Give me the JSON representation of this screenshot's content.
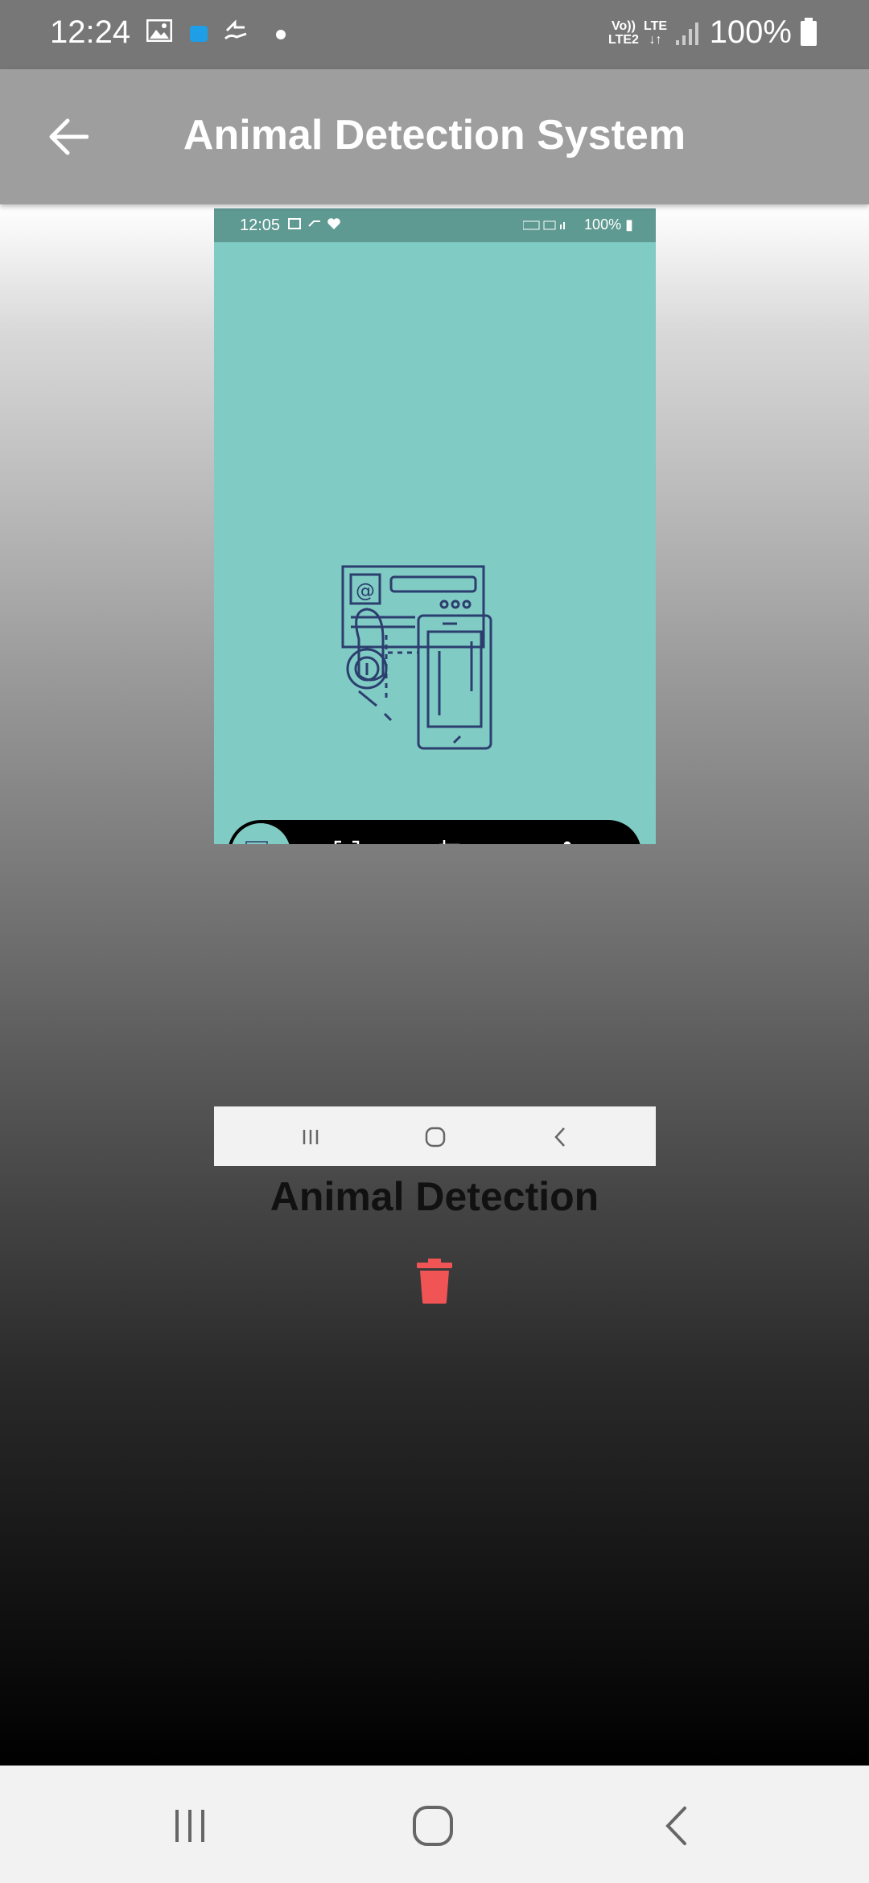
{
  "status_bar": {
    "time": "12:24",
    "network_top": "Vo))",
    "network_bottom": "LTE2",
    "lte_label": "LTE",
    "battery": "100%"
  },
  "app_bar": {
    "title": "Animal Detection System"
  },
  "screenshot": {
    "status_time": "12:05",
    "status_battery": "100%",
    "accent_color": "#80cbc4"
  },
  "caption": "Animal Detection",
  "colors": {
    "app_bar": "#9e9e9e",
    "status_bar": "#777777",
    "delete": "#f05454"
  }
}
